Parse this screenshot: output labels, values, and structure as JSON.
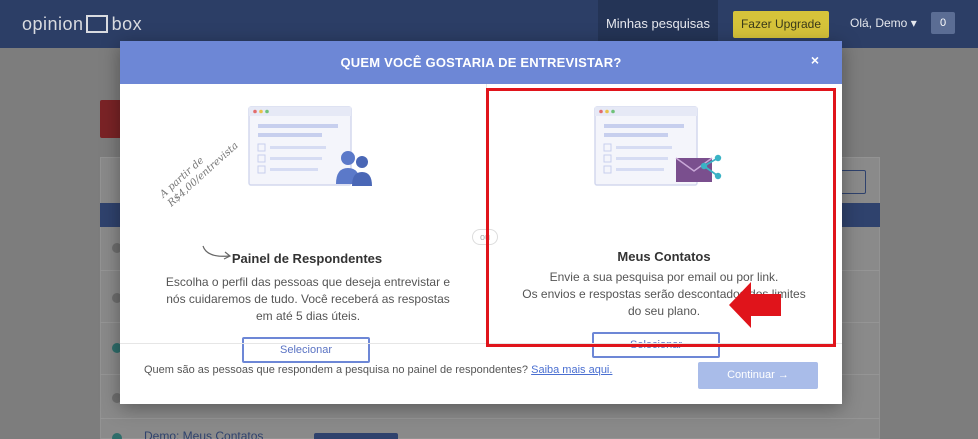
{
  "nav": {
    "logo_left": "opinion",
    "logo_right": "box",
    "link_surveys": "Minhas pesquisas",
    "upgrade": "Fazer Upgrade",
    "user": "Olá, Demo",
    "user_caret": "▾",
    "notifications": "0"
  },
  "background": {
    "list_item": "Demo: Meus Contatos"
  },
  "modal": {
    "title": "QUEM VOCÊ GOSTARIA DE ENTREVISTAR?",
    "close": "×",
    "or_label": "ou",
    "left": {
      "title": "Painel de Respondentes",
      "note_line1": "A partir de",
      "note_line2": "R$4,00/entrevista",
      "desc": [
        "Escolha o perfil das pessoas que deseja entrevistar e",
        "nós cuidaremos de tudo. Você receberá as respostas",
        "em até 5 dias úteis."
      ],
      "button": "Selecionar"
    },
    "right": {
      "title": "Meus Contatos",
      "desc": [
        "Envie a sua pesquisa por email ou por link.",
        "Os envios e respostas serão descontados dos limites",
        "do seu plano."
      ],
      "button": "Selecionar"
    },
    "footer": {
      "text": "Quem são as pessoas que respondem a pesquisa no painel de respondentes?",
      "link": "Saiba mais aqui.",
      "continue": "Continuar →"
    }
  },
  "colors": {
    "accent": "#6d87d6",
    "highlight": "#e0141b",
    "navbar": "#2c3e66"
  }
}
